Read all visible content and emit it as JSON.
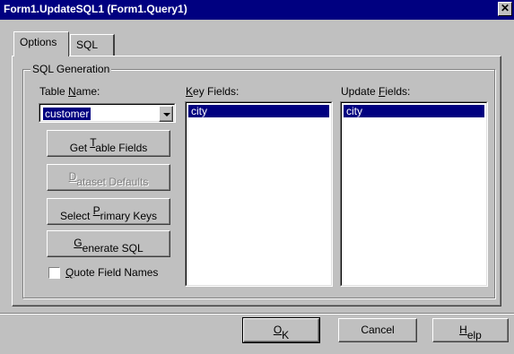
{
  "window": {
    "title": "Form1.UpdateSQL1 (Form1.Query1)",
    "close_glyph": "✕"
  },
  "tabs": [
    {
      "label": "Options",
      "active": true
    },
    {
      "label": "SQL",
      "active": false
    }
  ],
  "group": {
    "label": "SQL Generation"
  },
  "table_name": {
    "label_pre": "Table ",
    "label_mnemonic": "N",
    "label_post": "ame:",
    "value": "customer"
  },
  "buttons": {
    "get_table_fields": {
      "pre": "Get ",
      "mnemonic": "T",
      "post": "able Fields"
    },
    "dataset_defaults": {
      "pre": "",
      "mnemonic": "D",
      "post": "ataset Defaults"
    },
    "select_primary_keys": {
      "pre": "Select ",
      "mnemonic": "P",
      "post": "rimary Keys"
    },
    "generate_sql": {
      "pre": "",
      "mnemonic": "G",
      "post": "enerate SQL"
    }
  },
  "quote_field_names": {
    "pre": "",
    "mnemonic": "Q",
    "post": "uote Field Names",
    "checked": false
  },
  "key_fields": {
    "label_pre": "",
    "label_mnemonic": "K",
    "label_post": "ey Fields:",
    "items": [
      "city"
    ]
  },
  "update_fields": {
    "label_pre": "Update ",
    "label_mnemonic": "F",
    "label_post": "ields:",
    "items": [
      "city"
    ]
  },
  "footer": {
    "ok": {
      "pre": "",
      "mnemonic": "O",
      "post": "K"
    },
    "cancel": {
      "label": "Cancel"
    },
    "help": {
      "pre": "",
      "mnemonic": "H",
      "post": "elp"
    }
  }
}
